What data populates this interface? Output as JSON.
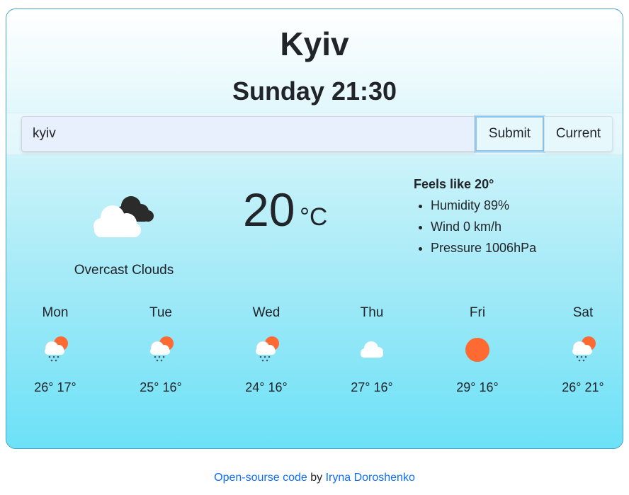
{
  "city": "Kyiv",
  "datetime": "Sunday 21:30",
  "search": {
    "value": "kyiv",
    "submit_label": "Submit",
    "current_label": "Current"
  },
  "current": {
    "icon": "overcast-clouds-icon",
    "description": "Overcast Clouds",
    "temperature": "20",
    "unit": "°C",
    "feels_like": "Feels like 20°",
    "details": [
      "Humidity 89%",
      "Wind 0 km/h",
      "Pressure 1006hPa"
    ]
  },
  "forecast": [
    {
      "day": "Mon",
      "icon": "rain-sun-icon",
      "temps": "26° 17°"
    },
    {
      "day": "Tue",
      "icon": "rain-sun-icon",
      "temps": "25° 16°"
    },
    {
      "day": "Wed",
      "icon": "rain-sun-icon",
      "temps": "24° 16°"
    },
    {
      "day": "Thu",
      "icon": "cloud-icon",
      "temps": "27° 16°"
    },
    {
      "day": "Fri",
      "icon": "sun-icon",
      "temps": "29° 16°"
    },
    {
      "day": "Sat",
      "icon": "rain-sun-icon",
      "temps": "26° 21°"
    }
  ],
  "footer": {
    "code_link": "Open-sourse code",
    "by": " by ",
    "author_link": "Iryna Doroshenko"
  },
  "colors": {
    "sun": "#ff6a33",
    "link": "#0d6efd",
    "border": "#4aa3c0"
  }
}
